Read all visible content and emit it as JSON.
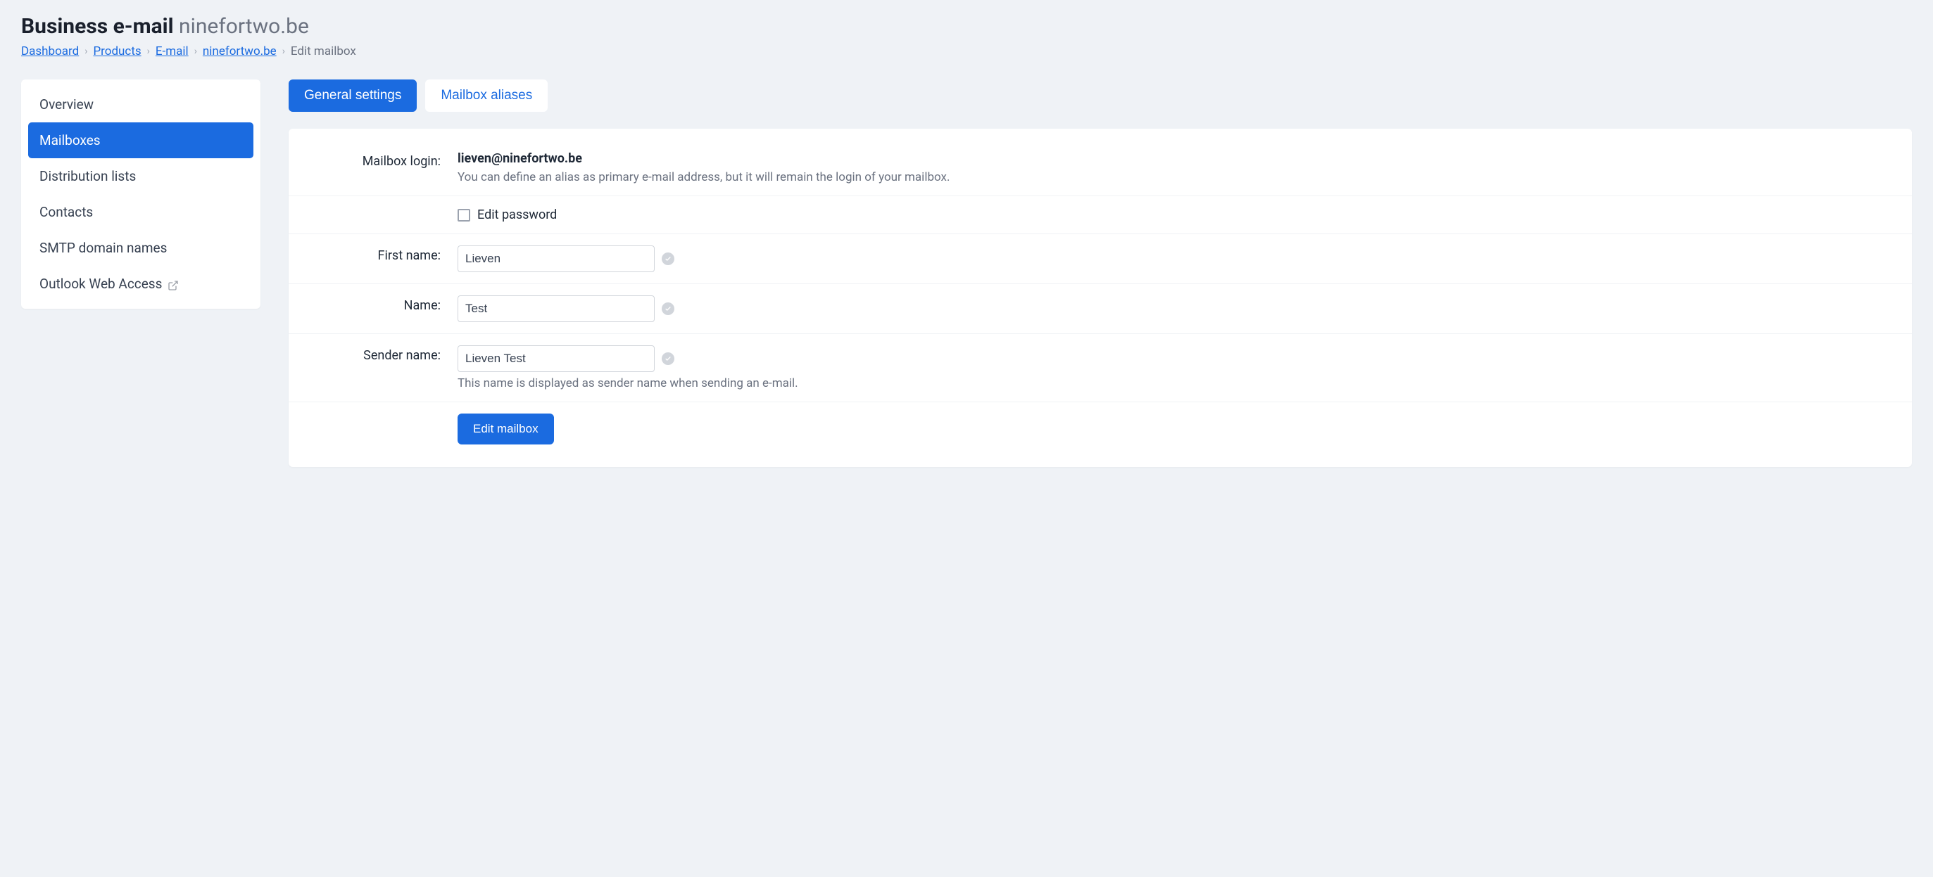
{
  "header": {
    "title_bold": "Business e-mail",
    "title_domain": "ninefortwo.be"
  },
  "breadcrumb": {
    "items": [
      {
        "label": "Dashboard",
        "link": true
      },
      {
        "label": "Products",
        "link": true
      },
      {
        "label": "E-mail",
        "link": true
      },
      {
        "label": "ninefortwo.be",
        "link": true
      },
      {
        "label": "Edit mailbox",
        "link": false
      }
    ]
  },
  "sidebar": {
    "items": [
      {
        "label": "Overview",
        "active": false,
        "external": false
      },
      {
        "label": "Mailboxes",
        "active": true,
        "external": false
      },
      {
        "label": "Distribution lists",
        "active": false,
        "external": false
      },
      {
        "label": "Contacts",
        "active": false,
        "external": false
      },
      {
        "label": "SMTP domain names",
        "active": false,
        "external": false
      },
      {
        "label": "Outlook Web Access",
        "active": false,
        "external": true
      }
    ]
  },
  "tabs": {
    "items": [
      {
        "label": "General settings",
        "active": true
      },
      {
        "label": "Mailbox aliases",
        "active": false
      }
    ]
  },
  "form": {
    "mailbox_login_label": "Mailbox login:",
    "mailbox_login_value": "lieven@ninefortwo.be",
    "mailbox_login_hint": "You can define an alias as primary e-mail address, but it will remain the login of your mailbox.",
    "edit_password_label": "Edit password",
    "first_name_label": "First name:",
    "first_name_value": "Lieven",
    "name_label": "Name:",
    "name_value": "Test",
    "sender_name_label": "Sender name:",
    "sender_name_value": "Lieven Test",
    "sender_name_hint": "This name is displayed as sender name when sending an e-mail.",
    "submit_label": "Edit mailbox"
  }
}
